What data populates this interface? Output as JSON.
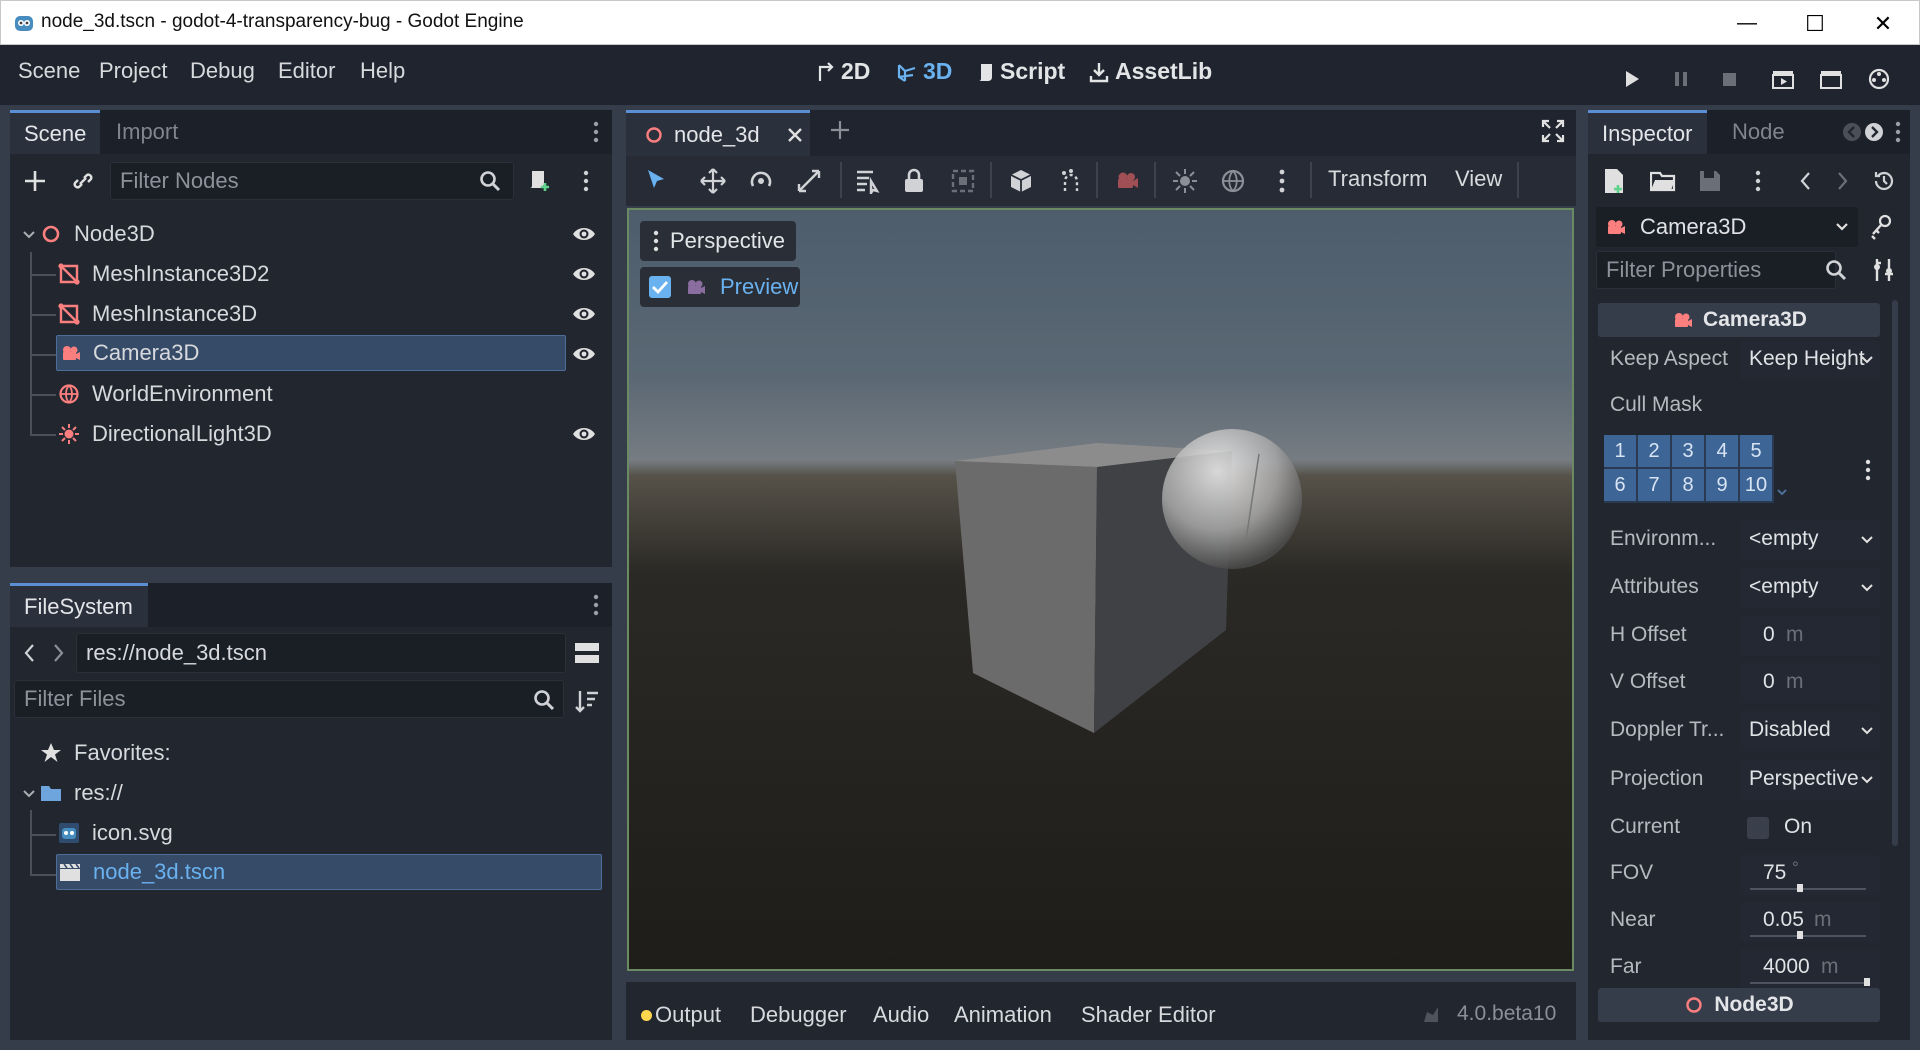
{
  "window": {
    "title": "node_3d.tscn - godot-4-transparency-bug - Godot Engine",
    "controls": {
      "minimize": "—",
      "maximize": "☐",
      "close": "✕"
    }
  },
  "menu": {
    "items": [
      "Scene",
      "Project",
      "Debug",
      "Editor",
      "Help"
    ]
  },
  "workspaces": {
    "w2d": "2D",
    "w3d": "3D",
    "script": "Script",
    "assetlib": "AssetLib",
    "active": "3D"
  },
  "scene_dock": {
    "tabs": [
      "Scene",
      "Import"
    ],
    "filter_placeholder": "Filter Nodes",
    "tree": [
      {
        "label": "Node3D",
        "icon": "node3d-icon",
        "color": "#fc7f7f"
      },
      {
        "label": "MeshInstance3D2",
        "icon": "mesh-instance-icon",
        "color": "#fc7f7f"
      },
      {
        "label": "MeshInstance3D",
        "icon": "mesh-instance-icon",
        "color": "#fc7f7f"
      },
      {
        "label": "Camera3D",
        "icon": "camera-icon",
        "color": "#fc7f7f",
        "selected": true
      },
      {
        "label": "WorldEnvironment",
        "icon": "world-environment-icon",
        "color": "#fc7f7f"
      },
      {
        "label": "DirectionalLight3D",
        "icon": "light-icon",
        "color": "#fc7f7f"
      }
    ]
  },
  "filesystem": {
    "tab": "FileSystem",
    "path": "res://node_3d.tscn",
    "filter_placeholder": "Filter Files",
    "items": [
      {
        "label": "Favorites:"
      },
      {
        "label": "res://"
      },
      {
        "label": "icon.svg"
      },
      {
        "label": "node_3d.tscn",
        "selected": true
      }
    ]
  },
  "editor": {
    "tab_label": "node_3d",
    "toolbar": {
      "transform": "Transform",
      "view": "View"
    },
    "viewport": {
      "perspective": "Perspective",
      "preview": "Preview",
      "preview_checked": true
    }
  },
  "bottom": {
    "tabs": [
      "Output",
      "Debugger",
      "Audio",
      "Animation",
      "Shader Editor"
    ],
    "version": "4.0.beta10"
  },
  "inspector": {
    "tabs": [
      "Inspector",
      "Node"
    ],
    "object": "Camera3D",
    "filter_placeholder": "Filter Properties",
    "section": "Camera3D",
    "keep_aspect": {
      "label": "Keep Aspect",
      "value": "Keep Height"
    },
    "cull_mask": {
      "label": "Cull Mask",
      "layers_row1": [
        "1",
        "2",
        "3",
        "4",
        "5"
      ],
      "layers_row2": [
        "6",
        "7",
        "8",
        "9",
        "10"
      ]
    },
    "environment": {
      "label": "Environm...",
      "value": "<empty"
    },
    "attributes": {
      "label": "Attributes",
      "value": "<empty"
    },
    "h_offset": {
      "label": "H Offset",
      "value": "0",
      "unit": "m"
    },
    "v_offset": {
      "label": "V Offset",
      "value": "0",
      "unit": "m"
    },
    "doppler": {
      "label": "Doppler Tr...",
      "value": "Disabled"
    },
    "projection": {
      "label": "Projection",
      "value": "Perspective"
    },
    "current": {
      "label": "Current",
      "value": "On",
      "checked": false
    },
    "fov": {
      "label": "FOV",
      "value": "75",
      "unit": "°"
    },
    "near": {
      "label": "Near",
      "value": "0.05",
      "unit": "m"
    },
    "far": {
      "label": "Far",
      "value": "4000",
      "unit": "m"
    },
    "next_section": "Node3D"
  }
}
